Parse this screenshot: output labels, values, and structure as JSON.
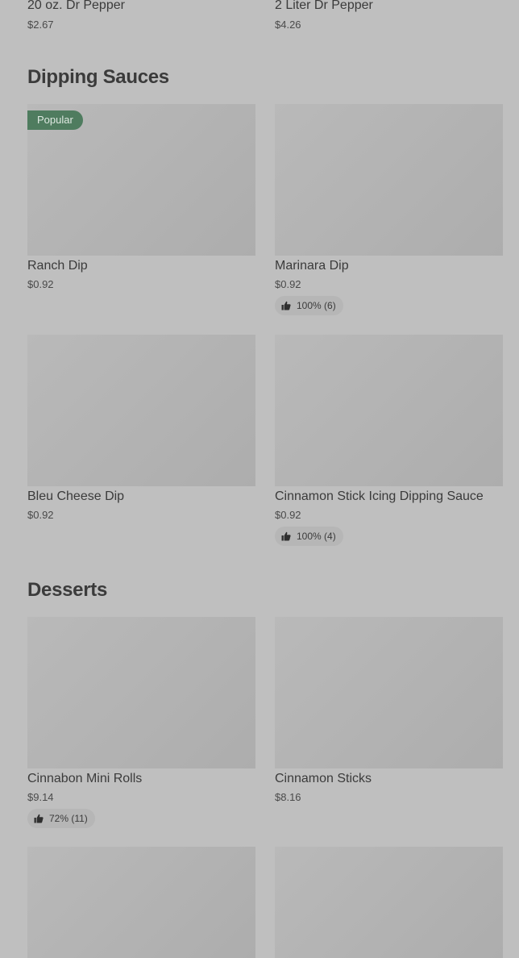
{
  "top_items": [
    {
      "name": "20 oz. Dr Pepper",
      "price": "$2.67"
    },
    {
      "name": "2 Liter Dr Pepper",
      "price": "$4.26"
    }
  ],
  "sections": {
    "dipping_sauces": {
      "title": "Dipping Sauces",
      "items": [
        {
          "name": "Ranch Dip",
          "price": "$0.92",
          "badge": "Popular"
        },
        {
          "name": "Marinara Dip",
          "price": "$0.92",
          "rating": "100% (6)"
        },
        {
          "name": "Bleu Cheese Dip",
          "price": "$0.92"
        },
        {
          "name": "Cinnamon Stick Icing Dipping Sauce",
          "price": "$0.92",
          "rating": "100% (4)"
        }
      ]
    },
    "desserts": {
      "title": "Desserts",
      "items": [
        {
          "name": "Cinnabon Mini Rolls",
          "price": "$9.14",
          "rating": "72% (11)"
        },
        {
          "name": "Cinnamon Sticks",
          "price": "$8.16"
        }
      ]
    }
  },
  "icons": {
    "rating": "thumbs-up-icon"
  },
  "colors": {
    "background": "#bfbfbf",
    "popular_badge": "#4f7c5f",
    "image_placeholder": "#b3b3b3"
  }
}
